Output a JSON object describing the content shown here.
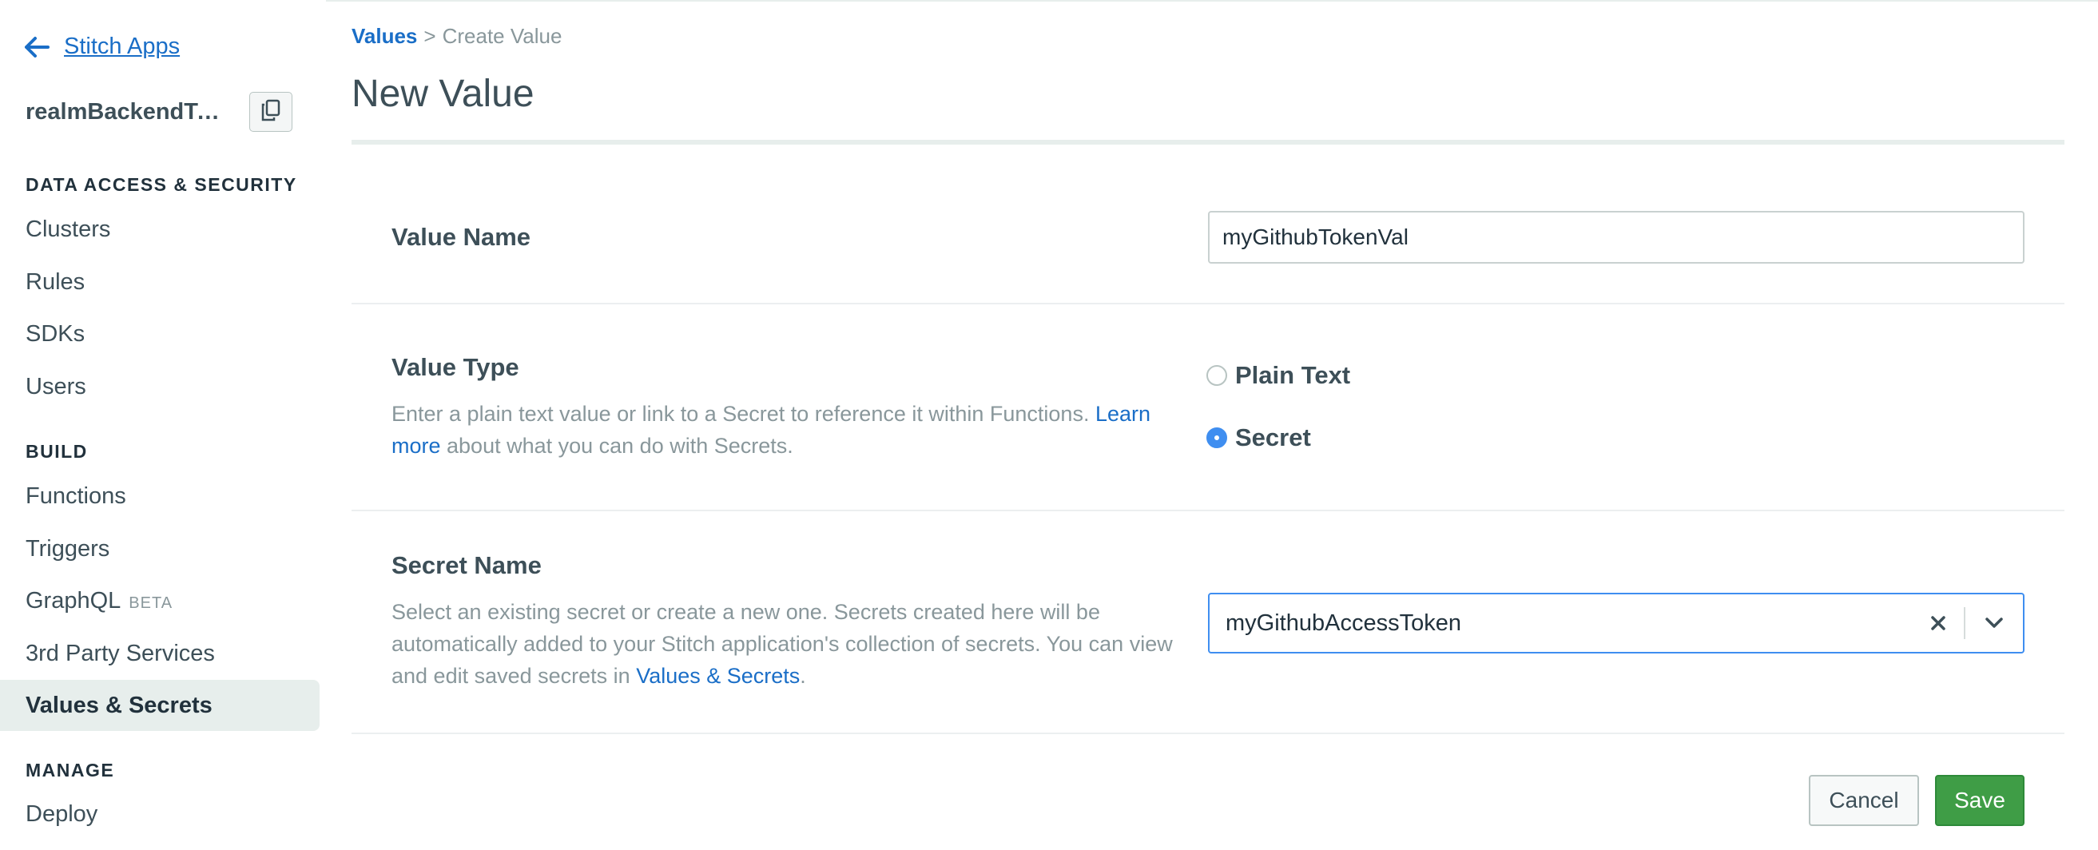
{
  "sidebar": {
    "back_label": "Stitch Apps",
    "app_name": "realmBackendTut...",
    "sections": [
      {
        "title": "DATA ACCESS & SECURITY",
        "items": [
          "Clusters",
          "Rules",
          "SDKs",
          "Users"
        ]
      },
      {
        "title": "BUILD",
        "items": [
          "Functions",
          "Triggers",
          "GraphQL",
          "3rd Party Services",
          "Values & Secrets"
        ]
      },
      {
        "title": "MANAGE",
        "items": [
          "Deploy"
        ]
      }
    ],
    "graphql_badge": "BETA",
    "active_item": "Values & Secrets"
  },
  "breadcrumb": {
    "parent": "Values",
    "separator": ">",
    "current": "Create Value"
  },
  "page_title": "New Value",
  "form": {
    "value_name": {
      "label": "Value Name",
      "value": "myGithubTokenVal"
    },
    "value_type": {
      "label": "Value Type",
      "description_pre": "Enter a plain text value or link to a Secret to reference it within Functions. ",
      "description_link": "Learn more",
      "description_post": " about what you can do with Secrets.",
      "options": [
        "Plain Text",
        "Secret"
      ],
      "selected": "Secret"
    },
    "secret_name": {
      "label": "Secret Name",
      "description_pre": "Select an existing secret or create a new one. Secrets created here will be automatically added to your Stitch application's collection of secrets. You can view and edit saved secrets in ",
      "description_link": "Values & Secrets",
      "description_post": ".",
      "selected_value": "myGithubAccessToken"
    }
  },
  "actions": {
    "cancel_label": "Cancel",
    "save_label": "Save"
  },
  "colors": {
    "link": "#1a6ec7",
    "accent_blue": "#3f8ef0",
    "save_green": "#3f9d46",
    "active_bg": "#e7eeec"
  },
  "icons": [
    "back-arrow-icon",
    "copy-icon",
    "clear-x-icon",
    "chevron-down-icon"
  ]
}
